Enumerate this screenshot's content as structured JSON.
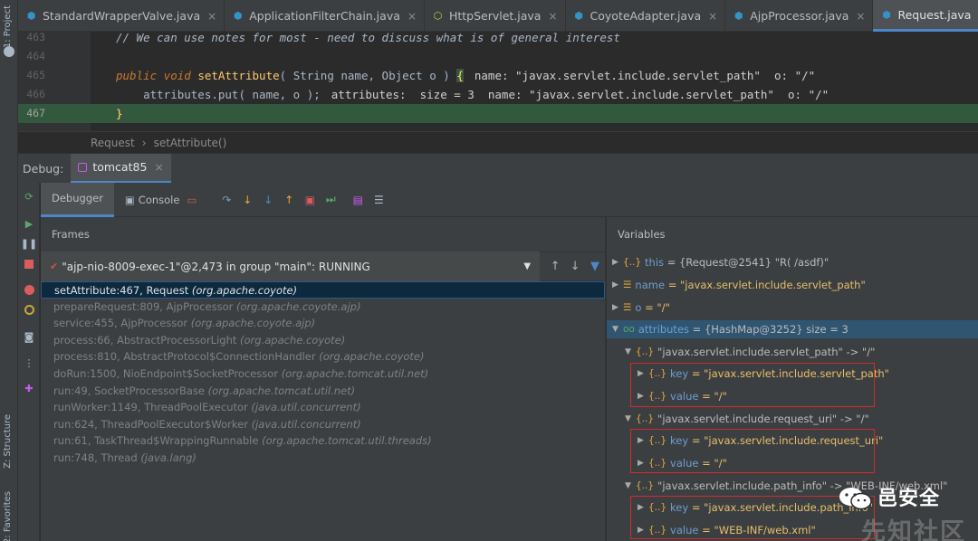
{
  "left_stripe": {
    "project_label": "1: Project",
    "structure_label": "Z: Structure",
    "favorites_label": "2: Favorites"
  },
  "tabs": [
    {
      "label": "StandardWrapperValve.java",
      "icon": "class-icon",
      "active": false
    },
    {
      "label": "ApplicationFilterChain.java",
      "icon": "class-icon",
      "active": false
    },
    {
      "label": "HttpServlet.java",
      "icon": "abstract-class-icon",
      "active": false
    },
    {
      "label": "CoyoteAdapter.java",
      "icon": "class-icon",
      "active": false
    },
    {
      "label": "AjpProcessor.java",
      "icon": "class-icon",
      "active": false
    },
    {
      "label": "Request.java",
      "icon": "class-icon",
      "active": true
    }
  ],
  "tab_close_glyph": "×",
  "editor": {
    "lines": [
      {
        "num": "463",
        "comment": "// We can use notes for most - need to discuss what is of general interest"
      },
      {
        "num": "464"
      },
      {
        "num": "465",
        "kw1": "public",
        "kw2": "void",
        "method": "setAttribute",
        "open": "( ",
        "type1": "String",
        "p1": " name, ",
        "type2": "Object",
        "p2": " o ) ",
        "brace": "{",
        "hint": "name: \"javax.servlet.include.servlet_path\"  o: \"/\""
      },
      {
        "num": "466",
        "code": "    attributes.put( name, o );",
        "hint": "attributes:  size = 3  name: \"javax.servlet.include.servlet_path\"  o: \"/\""
      },
      {
        "num": "467",
        "brace": "}",
        "current": true
      }
    ]
  },
  "breadcrumb": {
    "items": [
      "Request",
      "setAttribute()"
    ],
    "separator": "›"
  },
  "debug": {
    "label": "Debug:",
    "session_tab": "tomcat85",
    "toolbar": {
      "debugger_tab": "Debugger",
      "console_tab": "Console"
    },
    "frames_title": "Frames",
    "variables_title": "Variables",
    "thread": "\"ajp-nio-8009-exec-1\"@2,473 in group \"main\": RUNNING",
    "frames": [
      {
        "method": "setAttribute:467, Request",
        "pkg": "(org.apache.coyote)",
        "selected": true
      },
      {
        "method": "prepareRequest:809, AjpProcessor",
        "pkg": "(org.apache.coyote.ajp)"
      },
      {
        "method": "service:455, AjpProcessor",
        "pkg": "(org.apache.coyote.ajp)"
      },
      {
        "method": "process:66, AbstractProcessorLight",
        "pkg": "(org.apache.coyote)"
      },
      {
        "method": "process:810, AbstractProtocol$ConnectionHandler",
        "pkg": "(org.apache.coyote)"
      },
      {
        "method": "doRun:1500, NioEndpoint$SocketProcessor",
        "pkg": "(org.apache.tomcat.util.net)"
      },
      {
        "method": "run:49, SocketProcessorBase",
        "pkg": "(org.apache.tomcat.util.net)"
      },
      {
        "method": "runWorker:1149, ThreadPoolExecutor",
        "pkg": "(java.util.concurrent)"
      },
      {
        "method": "run:624, ThreadPoolExecutor$Worker",
        "pkg": "(java.util.concurrent)"
      },
      {
        "method": "run:61, TaskThread$WrappingRunnable",
        "pkg": "(org.apache.tomcat.util.threads)"
      },
      {
        "method": "run:748, Thread",
        "pkg": "(java.lang)"
      }
    ],
    "variables": [
      {
        "name": "this",
        "value": "= {Request@2541} \"R( /asdf)\""
      },
      {
        "name": "name",
        "value": "= \"javax.servlet.include.servlet_path\""
      },
      {
        "name": "o",
        "value": "= \"/\""
      },
      {
        "name": "attributes",
        "value": "= {HashMap@3252}  size = 3"
      },
      {
        "entry": "\"javax.servlet.include.servlet_path\" -> \"/\""
      },
      {
        "name": "key",
        "value": "= \"javax.servlet.include.servlet_path\""
      },
      {
        "name": "value",
        "value": "= \"/\""
      },
      {
        "entry": "\"javax.servlet.include.request_uri\" -> \"/\""
      },
      {
        "name": "key",
        "value": "= \"javax.servlet.include.request_uri\""
      },
      {
        "name": "value",
        "value": "= \"/\""
      },
      {
        "entry": "\"javax.servlet.include.path_info\" -> \"WEB-INF/web.xml\""
      },
      {
        "name": "key",
        "value": "= \"javax.servlet.include.path_info\""
      },
      {
        "name": "value",
        "value": "= \"WEB-INF/web.xml\""
      }
    ],
    "obj_glyph": "{..}",
    "map_glyph": "oo"
  },
  "watermark": {
    "line1": "邑安全",
    "line2": "先知社区"
  },
  "colors": {
    "accent": "#4a88c7",
    "current_line": "#32593d",
    "selection": "#0d293e",
    "highlight_box": "#d12a2a"
  }
}
